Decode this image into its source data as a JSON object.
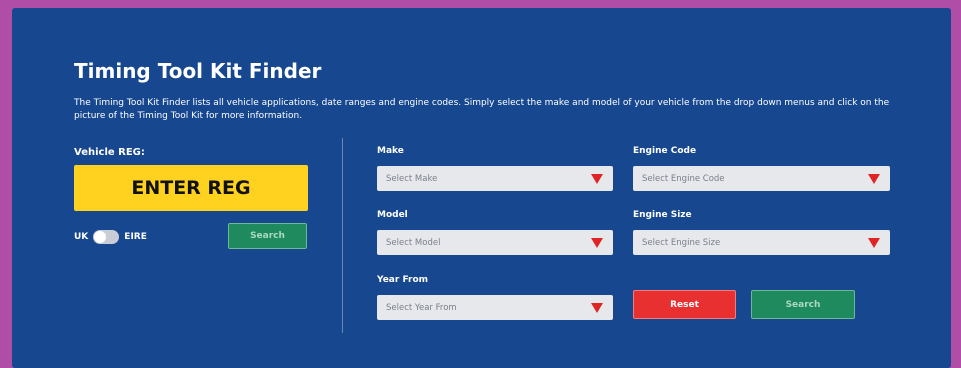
{
  "finder": {
    "title": "Timing Tool Kit Finder",
    "description": "The Timing Tool Kit Finder lists all vehicle applications, date ranges and engine codes. Simply select the make and model of your vehicle from the drop down menus and click on the picture of the Timing Tool Kit for more information."
  },
  "reg": {
    "label": "Vehicle REG:",
    "input_placeholder": "ENTER REG",
    "country_left": "UK",
    "country_right": "EIRE",
    "search_label": "Search"
  },
  "filters": {
    "make": {
      "label": "Make",
      "placeholder": "Select Make"
    },
    "model": {
      "label": "Model",
      "placeholder": "Select Model"
    },
    "year_from": {
      "label": "Year From",
      "placeholder": "Select Year From"
    },
    "engine_code": {
      "label": "Engine Code",
      "placeholder": "Select Engine Code"
    },
    "engine_size": {
      "label": "Engine Size",
      "placeholder": "Select Engine Size"
    },
    "reset_label": "Reset",
    "search_label": "Search"
  },
  "colors": {
    "panel": "#16478f",
    "border": "#b04ea7",
    "reg_yellow": "#ffd21f",
    "search_green": "#1e8a5e",
    "reset_red": "#e83030",
    "arrow_red": "#e02424"
  },
  "icons": {
    "select_arrow": "triangle-down-icon",
    "toggle": "toggle-switch"
  }
}
